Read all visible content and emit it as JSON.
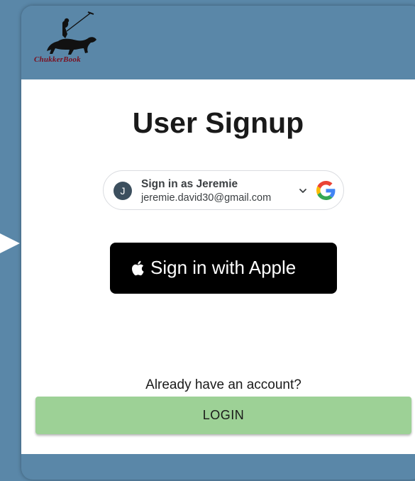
{
  "brand": {
    "logo_text": "ChukkerBook"
  },
  "signup": {
    "title": "User Signup"
  },
  "google": {
    "avatar_initial": "J",
    "name_label": "Sign in as Jeremie",
    "email": "jeremie.david30@gmail.com",
    "icon": "google-icon"
  },
  "apple": {
    "label": "Sign in with Apple",
    "icon": "apple-icon"
  },
  "login": {
    "prompt": "Already have an account?",
    "button_label": "LOGIN"
  },
  "colors": {
    "background": "#5a87a8",
    "login_button": "#9dd196",
    "apple_button": "#000000",
    "logo_text": "#7a1020"
  }
}
